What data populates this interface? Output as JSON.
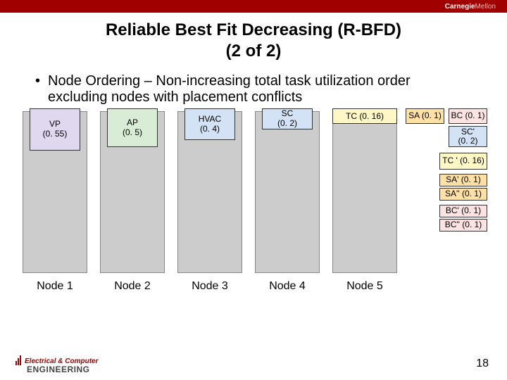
{
  "brand": {
    "part1": "Carnegie",
    "part2": "Mellon"
  },
  "title_line1": "Reliable Best Fit Decreasing (R-BFD)",
  "title_line2": "(2 of 2)",
  "bullet_text": "Node Ordering – Non-increasing total task utilization order excluding nodes with placement conflicts",
  "tasks": {
    "vp": {
      "name": "VP",
      "util": "(0. 55)"
    },
    "ap": {
      "name": "AP",
      "util": "(0. 5)"
    },
    "hvac": {
      "name": "HVAC",
      "util": "(0. 4)"
    },
    "sc": {
      "name": "SC",
      "util": "(0. 2)"
    },
    "tc": {
      "label": "TC (0. 16)"
    },
    "sa": {
      "label": "SA (0. 1)"
    },
    "bc": {
      "label": "BC (0. 1)"
    },
    "scp": {
      "name": "SC'",
      "util": "(0. 2)"
    },
    "tcp": {
      "label": "TC ' (0. 16)"
    },
    "sap": {
      "label": "SA' (0. 1)"
    },
    "sapp": {
      "label": "SA'' (0. 1)"
    },
    "bcp": {
      "label": "BC' (0. 1)"
    },
    "bcpp": {
      "label": "BC'' (0. 1)"
    }
  },
  "nodes": {
    "n1": "Node 1",
    "n2": "Node 2",
    "n3": "Node 3",
    "n4": "Node 4",
    "n5": "Node 5"
  },
  "footer": {
    "ec": "Electrical & Computer",
    "eng": "ENGINEERING",
    "page": "18"
  },
  "chart_data": {
    "type": "table",
    "title": "R-BFD node ordering by non-increasing total task utilization",
    "series": [
      {
        "name": "VP",
        "values": [
          0.55
        ]
      },
      {
        "name": "AP",
        "values": [
          0.5
        ]
      },
      {
        "name": "HVAC",
        "values": [
          0.4
        ]
      },
      {
        "name": "SC",
        "values": [
          0.2
        ]
      },
      {
        "name": "TC",
        "values": [
          0.16
        ]
      },
      {
        "name": "SA",
        "values": [
          0.1
        ]
      },
      {
        "name": "BC",
        "values": [
          0.1
        ]
      },
      {
        "name": "SC'",
        "values": [
          0.2
        ]
      },
      {
        "name": "TC'",
        "values": [
          0.16
        ]
      },
      {
        "name": "SA'",
        "values": [
          0.1
        ]
      },
      {
        "name": "SA''",
        "values": [
          0.1
        ]
      },
      {
        "name": "BC'",
        "values": [
          0.1
        ]
      },
      {
        "name": "BC''",
        "values": [
          0.1
        ]
      }
    ],
    "categories": [
      "Node 1",
      "Node 2",
      "Node 3",
      "Node 4",
      "Node 5"
    ]
  }
}
